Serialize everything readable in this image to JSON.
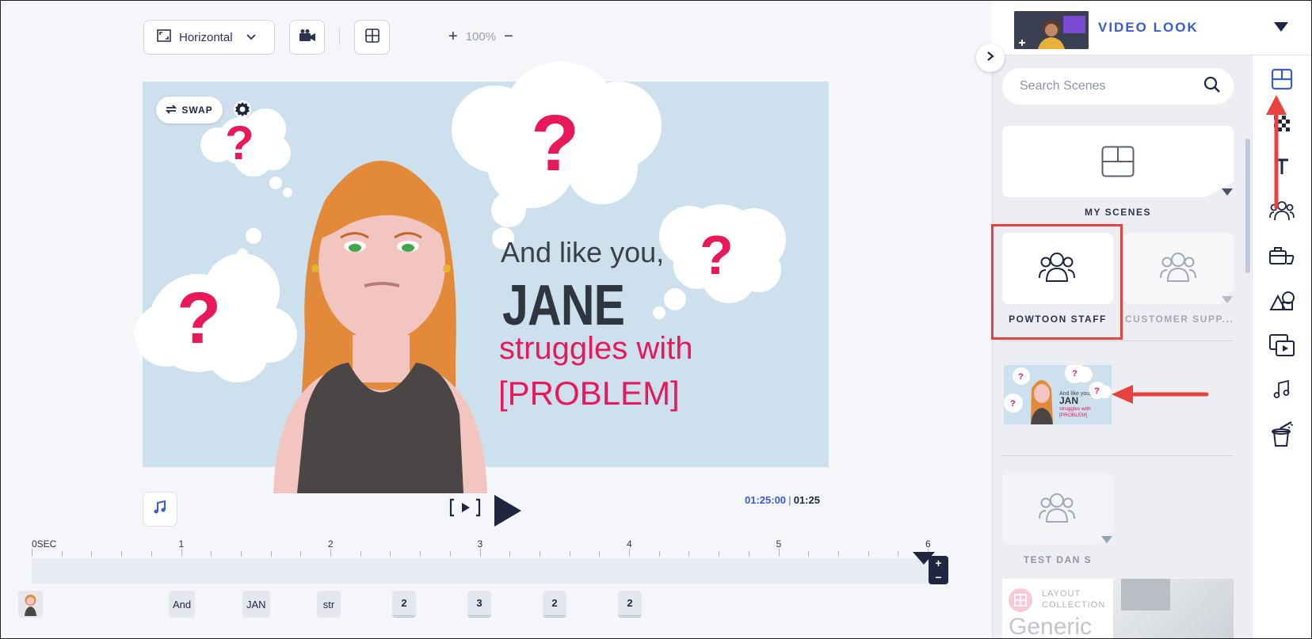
{
  "toolbar": {
    "orientation_label": "Horizontal",
    "zoom_level": "100%"
  },
  "canvas": {
    "swap_label": "SWAP",
    "line1": "And like you,",
    "line2": "JANE",
    "line3": "struggles with",
    "line4": "[PROBLEM]",
    "question_mark": "?"
  },
  "playback": {
    "current_time": "01:25:00",
    "total_time": "01:25"
  },
  "timeline": {
    "ruler_labels": [
      "0SEC",
      "1",
      "2",
      "3",
      "4",
      "5",
      "6"
    ],
    "chips": [
      "And",
      "JAN",
      "str",
      "2",
      "3",
      "2",
      "2"
    ]
  },
  "panel": {
    "look_title": "VIDEO LOOK",
    "search_placeholder": "Search Scenes",
    "my_scenes_label": "MY SCENES",
    "powtoon_staff_label": "POWTOON STAFF",
    "customer_support_label": "CUSTOMER SUPP...",
    "test_label": "TEST DAN S",
    "layout_line1": "LAYOUT",
    "layout_line2": "COLLECTION",
    "layout_name": "Generic",
    "thumb_line1": "And like you,",
    "thumb_line2": "JAN",
    "thumb_line3": "struggles with",
    "thumb_line4": "[PROBLEM]"
  },
  "colors": {
    "accent": "#3a5bd9",
    "brand_pink": "#e8185b",
    "annotation_red": "#e8423f",
    "canvas_bg": "#cde0ee"
  },
  "rail_icons": [
    "layout-icon",
    "background-icon",
    "text-icon",
    "characters-icon",
    "props-icon",
    "shapes-icon",
    "media-icon",
    "music-icon",
    "magic-icon"
  ]
}
